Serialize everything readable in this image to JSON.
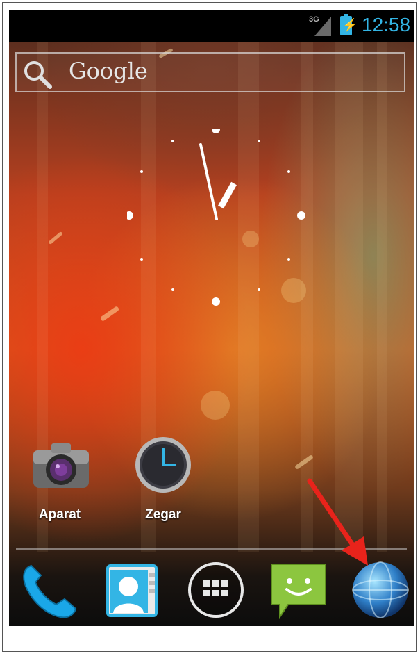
{
  "status_bar": {
    "network_type": "3G",
    "time": "12:58",
    "accent_color": "#33b5e5",
    "icons": [
      "signal-icon",
      "battery-charging-icon"
    ]
  },
  "search_widget": {
    "label": "Google",
    "icon": "search-icon"
  },
  "clock_widget": {
    "type": "analog-clock",
    "hour": 12,
    "minute": 58
  },
  "apps": [
    {
      "label": "Aparat",
      "icon": "camera-icon"
    },
    {
      "label": "Zegar",
      "icon": "clock-icon"
    }
  ],
  "dock": [
    {
      "icon": "phone-icon"
    },
    {
      "icon": "contacts-icon"
    },
    {
      "icon": "all-apps-icon"
    },
    {
      "icon": "messaging-icon"
    },
    {
      "icon": "browser-globe-icon"
    }
  ],
  "annotation": {
    "icon": "red-arrow-icon",
    "color": "#e8231b"
  }
}
